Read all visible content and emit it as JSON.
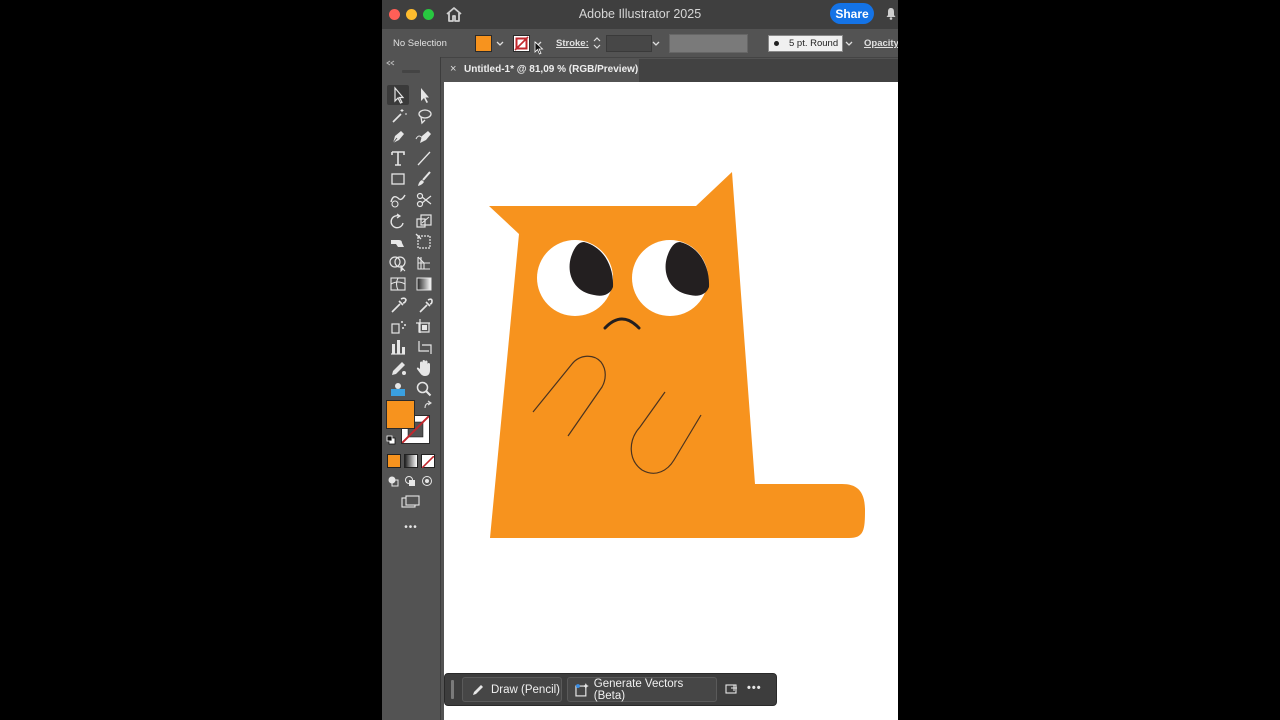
{
  "app": {
    "title": "Adobe Illustrator 2025",
    "share_label": "Share"
  },
  "control_bar": {
    "selection_status": "No Selection",
    "fill_color": "#f7931e",
    "stroke_label": "Stroke:",
    "stroke_weight": "",
    "brush_label": "5 pt. Round",
    "opacity_label": "Opacity"
  },
  "document_tab": {
    "title": "Untitled-1* @ 81,09 % (RGB/Preview)",
    "close_glyph": "×"
  },
  "toolbar": {
    "tools": [
      "selection-tool",
      "direct-selection-tool",
      "magic-wand-tool",
      "lasso-tool",
      "pen-tool",
      "curvature-tool",
      "type-tool",
      "line-segment-tool",
      "rectangle-tool",
      "paintbrush-tool",
      "shaper-tool",
      "scissors-tool",
      "rotate-tool",
      "scale-tool",
      "warp-tool",
      "free-transform-tool",
      "shape-builder-tool",
      "perspective-grid-tool",
      "mesh-tool",
      "gradient-tool",
      "eyedropper-tool",
      "blend-tool",
      "symbol-sprayer-tool",
      "artboard-tool",
      "column-graph-tool",
      "slice-tool",
      "pencil-tool",
      "hand-tool",
      "puppet-warp-tool",
      "zoom-tool"
    ],
    "fill_color": "#f7931e",
    "more_label": "•••"
  },
  "artwork": {
    "cat_color": "#f7931e",
    "eye_white": "#ffffff",
    "pupil_color": "#231f20",
    "line_color": "#3a2a1a"
  },
  "task_bar": {
    "draw_label": "Draw (Pencil)",
    "generate_label": "Generate Vectors (Beta)",
    "more_label": "•••"
  }
}
